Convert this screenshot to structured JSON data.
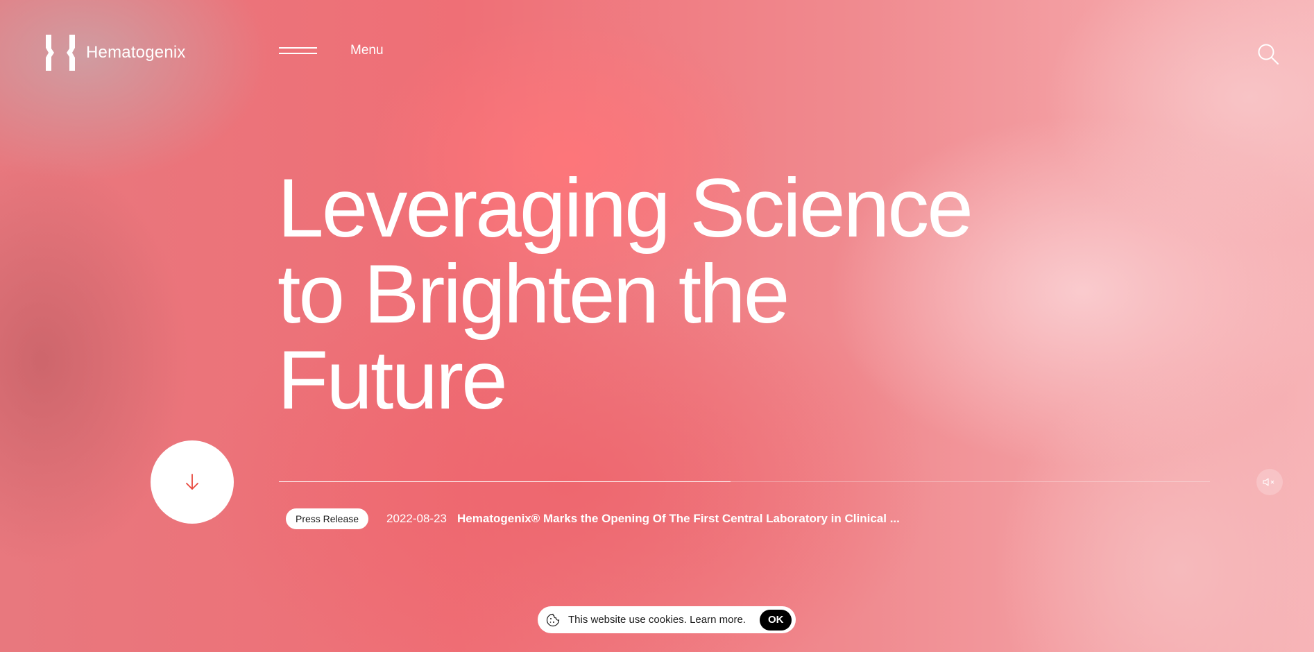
{
  "brand": {
    "name": "Hematogenix",
    "logo_icon": "hematogenix-logo-icon"
  },
  "header": {
    "menu_label": "Menu",
    "menu_icon": "hamburger-icon",
    "search_icon": "search-icon"
  },
  "hero": {
    "title_lines": [
      "Leveraging Science",
      "to Brighten the",
      "Future"
    ],
    "scroll_icon": "arrow-down-icon",
    "mute_icon": "speaker-muted-icon",
    "progress": 0.485
  },
  "news": {
    "badge": "Press Release",
    "date": "2022-08-23",
    "headline": "Hematogenix® Marks the Opening Of The First Central Laboratory in Clinical ..."
  },
  "cookie": {
    "icon": "cookie-icon",
    "text": "This website use cookies. Learn more.",
    "ok_label": "OK"
  },
  "colors": {
    "accent": "#e8473c",
    "background_primary": "#ef6f76",
    "background_light": "#f7b3b6"
  }
}
